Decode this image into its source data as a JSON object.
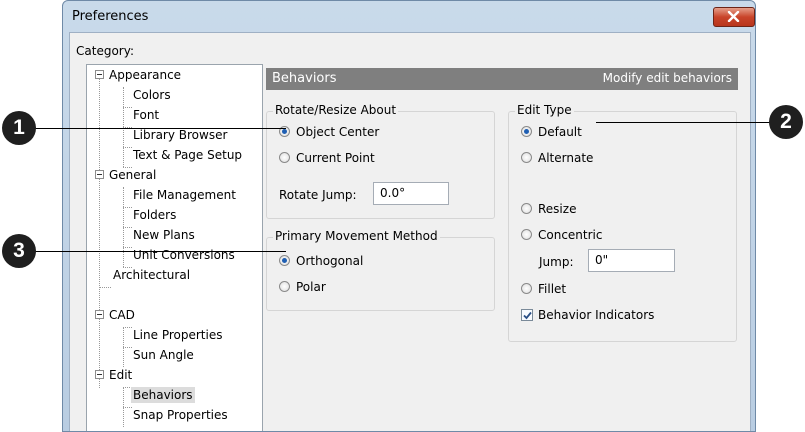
{
  "window": {
    "title": "Preferences",
    "close_icon": "close-x-icon"
  },
  "category_label": "Category:",
  "tree": [
    "Appearance",
    "Colors",
    "Font",
    "Library Browser",
    "Text & Page Setup",
    "General",
    "File Management",
    "Folders",
    "New Plans",
    "Unit Conversions",
    "Architectural",
    "CAD",
    "Line Properties",
    "Sun Angle",
    "Edit",
    "Behaviors",
    "Snap Properties"
  ],
  "panel": {
    "title": "Behaviors",
    "subtitle": "Modify edit behaviors"
  },
  "rotate_resize": {
    "label": "Rotate/Resize About",
    "options": [
      "Object Center",
      "Current Point"
    ],
    "selected": "Object Center",
    "jump_label": "Rotate Jump:",
    "jump_value": "0.0°"
  },
  "movement": {
    "label": "Primary Movement Method",
    "options": [
      "Orthogonal",
      "Polar"
    ],
    "selected": "Orthogonal"
  },
  "edit_type": {
    "label": "Edit Type",
    "options": [
      "Default",
      "Alternate",
      "Resize",
      "Concentric",
      "Fillet"
    ],
    "selected": "Default",
    "jump_label": "Jump:",
    "jump_value": "0\"",
    "behavior_indicators_label": "Behavior Indicators",
    "behavior_indicators_checked": true
  },
  "callouts": [
    "1",
    "2",
    "3"
  ]
}
